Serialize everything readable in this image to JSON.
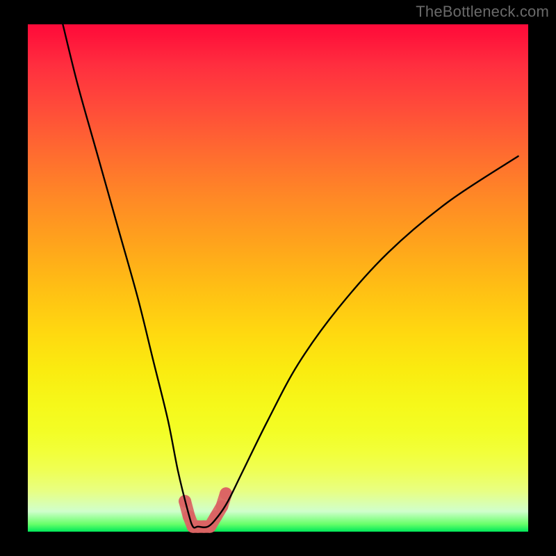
{
  "watermark": {
    "text": "TheBottleneck.com",
    "color": "#6a6a6a"
  },
  "chart_data": {
    "type": "line",
    "title": "",
    "xlabel": "",
    "ylabel": "",
    "xlim": [
      0,
      100
    ],
    "ylim": [
      0,
      100
    ],
    "grid": false,
    "legend": false,
    "series": [
      {
        "name": "bottleneck-curve",
        "x": [
          7,
          10,
          14,
          18,
          22,
          25,
          28,
          30,
          32,
          33,
          34,
          36,
          38,
          40,
          43,
          48,
          54,
          62,
          72,
          84,
          98
        ],
        "y": [
          100,
          88,
          74,
          60,
          46,
          34,
          22,
          12,
          4,
          1,
          1,
          1,
          3,
          6,
          12,
          22,
          33,
          44,
          55,
          65,
          74
        ],
        "color": "#000000",
        "stroke_width": 2.4
      },
      {
        "name": "highlight-trough",
        "x": [
          31.4,
          32.2,
          33.0,
          34.0,
          35.2,
          36.4,
          37.6,
          38.8,
          39.6
        ],
        "y": [
          6.0,
          3.0,
          1.0,
          1.0,
          1.0,
          1.0,
          3.0,
          5.0,
          7.5
        ],
        "color": "#db6464",
        "stroke_width": 18,
        "linecap": "round",
        "dash": true
      }
    ],
    "background_gradient": {
      "orientation": "vertical",
      "stops": [
        {
          "pos": 0.0,
          "color": "#ff0b3a"
        },
        {
          "pos": 0.5,
          "color": "#ffbf14"
        },
        {
          "pos": 0.8,
          "color": "#f3fd25"
        },
        {
          "pos": 0.96,
          "color": "#d0ffcc"
        },
        {
          "pos": 1.0,
          "color": "#00e85a"
        }
      ]
    }
  }
}
